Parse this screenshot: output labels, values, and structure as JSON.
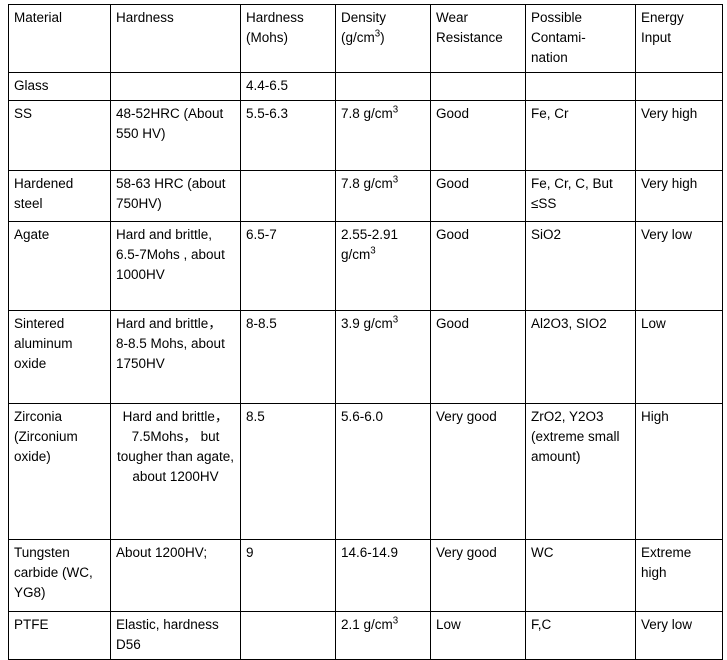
{
  "table": {
    "columns": [
      "Material",
      "Hardness",
      "Hardness (Mohs)",
      "Density (g/cm3)",
      "Wear Resistance",
      "Possible Contami-nation",
      "Energy Input"
    ],
    "headers": {
      "material": "Material",
      "hardness": "Hardness",
      "hardness_mohs_line1": "Hardness",
      "hardness_mohs_line2": "(Mohs)",
      "density_line1": "Density",
      "density_line2_pre": "(g/cm",
      "density_line2_sup": "3",
      "density_line2_post": ")",
      "wear_line1": "Wear",
      "wear_line2": "Resistance",
      "contamination_line1": "Possible",
      "contamination_line2": "Contami-",
      "contamination_line3": "nation",
      "energy_line1": "Energy",
      "energy_line2": "Input"
    },
    "rows": [
      {
        "material": "Glass",
        "hardness": "",
        "hardness_mohs": "4.4-6.5",
        "density": "",
        "density_sup": "",
        "wear_resistance": "",
        "contamination": "",
        "energy_input": ""
      },
      {
        "material": "SS",
        "hardness": "48-52HRC (About 550 HV)",
        "hardness_mohs": "5.5-6.3",
        "density": "7.8 g/cm",
        "density_sup": "3",
        "wear_resistance": "Good",
        "contamination": "Fe, Cr",
        "energy_input": "Very high"
      },
      {
        "material": "Hardened steel",
        "hardness": "58-63 HRC (about  750HV)",
        "hardness_mohs": "",
        "density": "7.8 g/cm",
        "density_sup": "3",
        "wear_resistance": "Good",
        "contamination": "Fe, Cr, C, But ≤SS",
        "energy_input": "Very high"
      },
      {
        "material": "Agate",
        "hardness": "Hard and brittle, 6.5-7Mohs , about 1000HV",
        "hardness_mohs": "6.5-7",
        "density": "2.55-2.91 g/cm",
        "density_sup": "3",
        "wear_resistance": "Good",
        "contamination": "SiO2",
        "energy_input": "Very low"
      },
      {
        "material": "Sintered aluminum oxide",
        "hardness": "Hard and brittle， 8-8.5 Mohs, about 1750HV",
        "hardness_mohs": "8-8.5",
        "density": "3.9 g/cm",
        "density_sup": "3",
        "wear_resistance": "Good",
        "contamination": "Al2O3, SIO2",
        "energy_input": "Low"
      },
      {
        "material": "Zirconia (Zirconium oxide)",
        "hardness": "Hard and brittle，7.5Mohs， but tougher than agate, about 1200HV",
        "hardness_mohs": "8.5",
        "density": "5.6-6.0",
        "density_sup": "",
        "wear_resistance": "Very good",
        "contamination": "ZrO2, Y2O3 (extreme small amount)",
        "energy_input": "High"
      },
      {
        "material": "Tungsten carbide (WC, YG8)",
        "hardness": "About 1200HV;",
        "hardness_mohs": "9",
        "density": "14.6-14.9",
        "density_sup": "",
        "wear_resistance": "Very good",
        "contamination": "WC",
        "energy_input": "Extreme high"
      },
      {
        "material": "PTFE",
        "hardness": "Elastic, hardness D56",
        "hardness_mohs": "",
        "density": "2.1 g/cm",
        "density_sup": "3",
        "wear_resistance": "Low",
        "contamination": "F,C",
        "energy_input": "Very low"
      }
    ]
  },
  "style": {
    "border_color": "#000000",
    "text_color": "#000000",
    "background": "#ffffff"
  }
}
